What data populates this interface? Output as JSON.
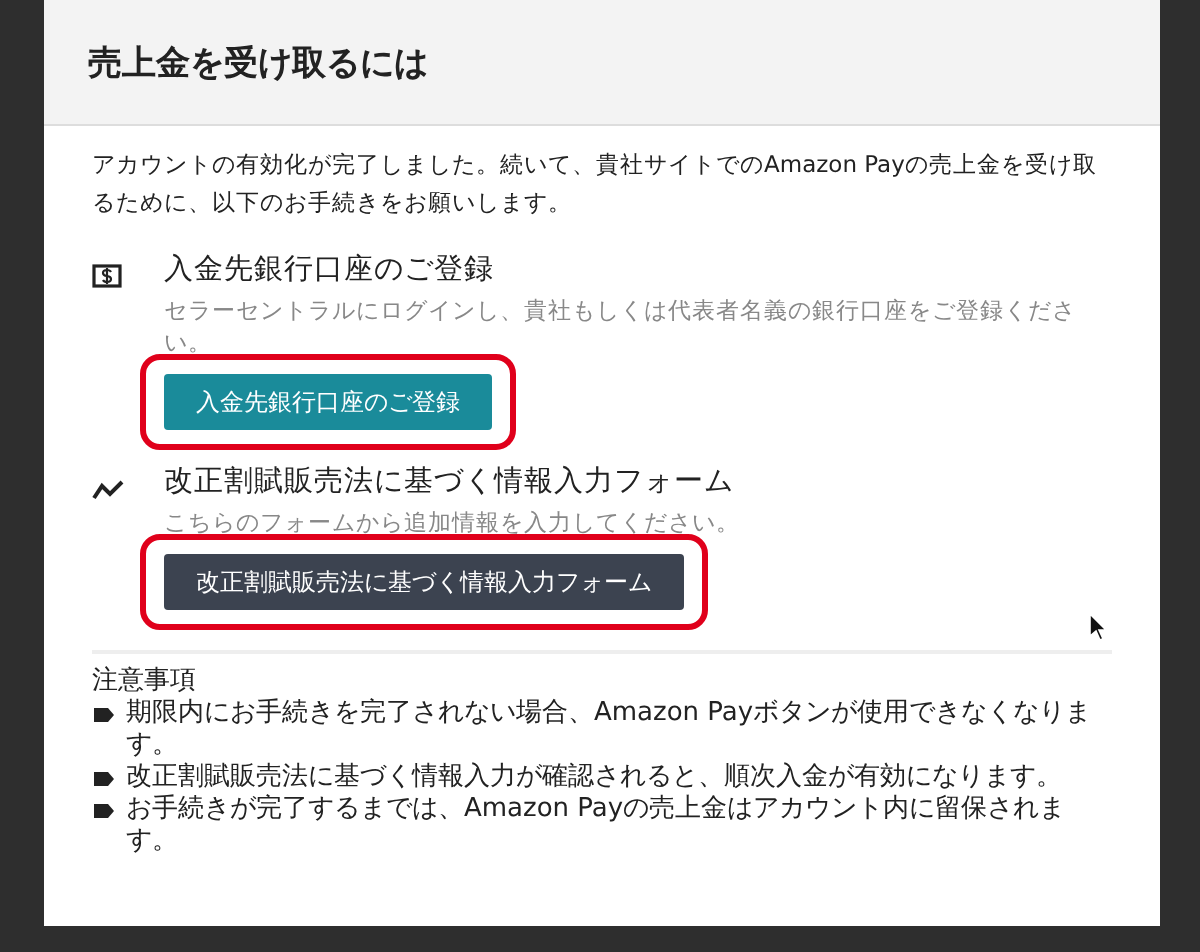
{
  "dialog": {
    "title": "売上金を受け取るには"
  },
  "intro": "アカウントの有効化が完了しました。続いて、貴社サイトでのAmazon Payの売上金を受け取るために、以下のお手続きをお願いします。",
  "steps": [
    {
      "kind": "bank",
      "title": "入金先銀行口座のご登録",
      "description": "セラーセントラルにログインし、貴社もしくは代表者名義の銀行口座をご登録ください。",
      "button": {
        "label": "入金先銀行口座のご登録",
        "kind": "primary",
        "highlighted": true
      }
    },
    {
      "kind": "chart",
      "title": "改正割賦販売法に基づく情報入力フォーム",
      "description": "こちらのフォームから追加情報を入力してください。",
      "button": {
        "label": "改正割賦販売法に基づく情報入力フォーム",
        "kind": "secondary",
        "highlighted": true
      }
    }
  ],
  "notes": {
    "heading": "注意事項",
    "items": [
      "期限内にお手続きを完了されない場合、Amazon Payボタンが使用できなくなります。",
      "改正割賦販売法に基づく情報入力が確認されると、順次入金が有効になります。",
      "お手続きが完了するまでは、Amazon Payの売上金はアカウント内に留保されます。"
    ]
  }
}
